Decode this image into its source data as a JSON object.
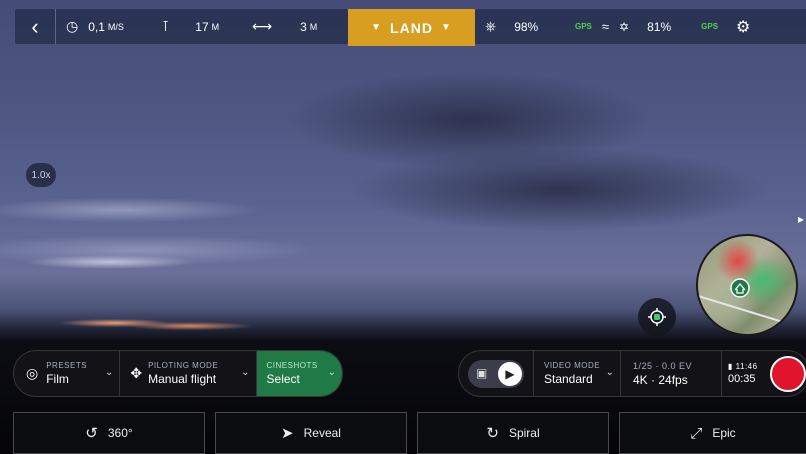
{
  "topbar": {
    "speed_value": "0,1",
    "speed_unit": "M/S",
    "altitude_value": "17",
    "altitude_unit": "M",
    "distance_value": "3",
    "distance_unit": "M",
    "land_label": "LAND",
    "controller_battery": "98%",
    "gps_label_1": "GPS",
    "drone_battery": "81%",
    "gps_label_2": "GPS"
  },
  "zoom_label": "1.0x",
  "presets": {
    "label": "PRESETS",
    "value": "Film"
  },
  "piloting": {
    "label": "PILOTING MODE",
    "value": "Manual flight"
  },
  "cineshots": {
    "label": "CINESHOTS",
    "value": "Select"
  },
  "video_mode": {
    "label": "VIDEO MODE",
    "value": "Standard"
  },
  "exposure": {
    "line1": "1/25 · 0.0 EV",
    "line2": "4K · 24fps"
  },
  "storage": {
    "time_left": "11:46",
    "rec_time": "00:35"
  },
  "bottom_buttons": {
    "b360": "360°",
    "reveal": "Reveal",
    "spiral": "Spiral",
    "epic": "Epic"
  },
  "colors": {
    "land": "#d89e21",
    "cineshots": "#1f7a45",
    "record": "#e0142c",
    "gps": "#4fd14f"
  }
}
